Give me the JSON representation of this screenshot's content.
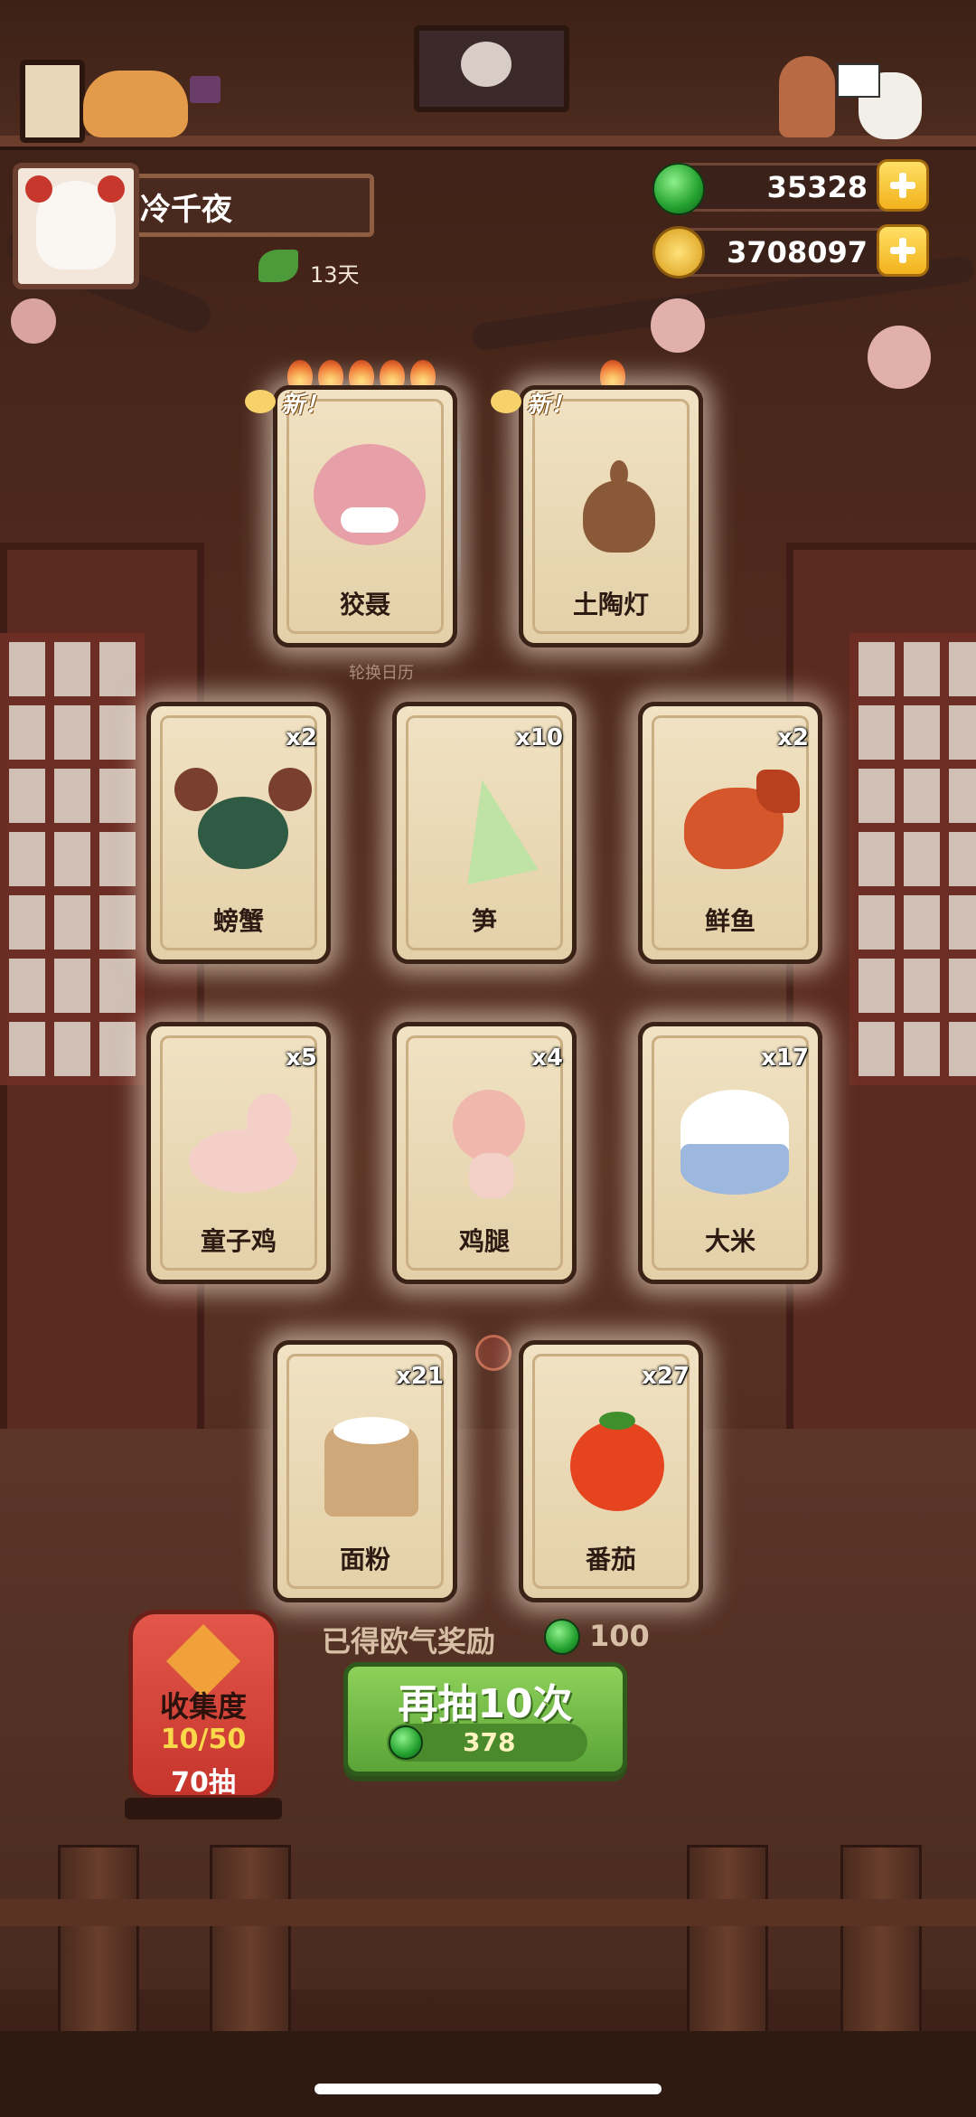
{
  "player": {
    "name": "冷千夜",
    "days": "13天"
  },
  "currency": {
    "jade": "35328",
    "coins": "3708097"
  },
  "top_scroll": {
    "label": "轮换日历"
  },
  "featured_cards": [
    {
      "label": "狡聂",
      "new": "新！",
      "stars": 5
    },
    {
      "label": "土陶灯",
      "new": "新！",
      "stars": 1
    }
  ],
  "cards": [
    {
      "label": "螃蟹",
      "count": "x2"
    },
    {
      "label": "笋",
      "count": "x10"
    },
    {
      "label": "鲜鱼",
      "count": "x2"
    },
    {
      "label": "童子鸡",
      "count": "x5"
    },
    {
      "label": "鸡腿",
      "count": "x4"
    },
    {
      "label": "大米",
      "count": "x17"
    },
    {
      "label": "面粉",
      "count": "x21"
    },
    {
      "label": "番茄",
      "count": "x27"
    }
  ],
  "reward": {
    "label": "已得欧气奖励",
    "value": "100"
  },
  "lantern": {
    "title": "收集度",
    "progress": "10/50",
    "pulls": "70抽"
  },
  "redraw": {
    "label": "再抽10次",
    "cost": "378"
  },
  "colors": {
    "jade": "#23a02f",
    "gold": "#f2b21c",
    "button_green": "#5aa437",
    "lantern_red": "#c7352c"
  }
}
